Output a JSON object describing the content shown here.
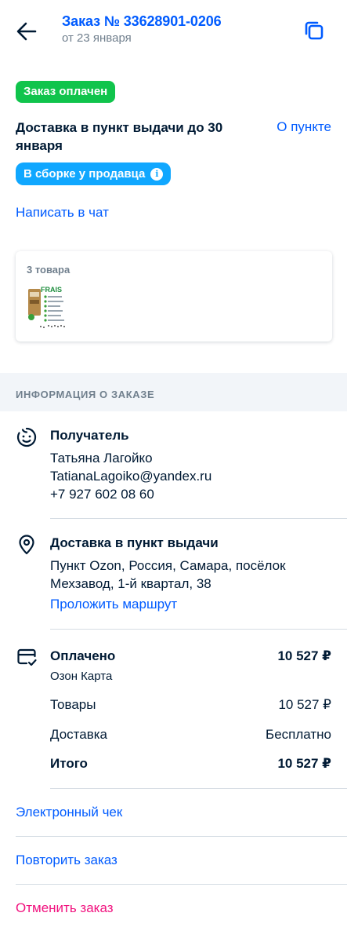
{
  "header": {
    "order_title": "Заказ № 33628901-0206",
    "order_date": "от 23 января"
  },
  "status": {
    "paid_badge": "Заказ оплачен",
    "delivery_title": "Доставка в пункт выдачи до 30 января",
    "about_point_link": "О пункте",
    "assembly_badge": "В сборке у продавца",
    "chat_link": "Написать в чат"
  },
  "items": {
    "count_label": "3 товара",
    "thumbnail": {
      "brand": "FRAIS"
    }
  },
  "order_info": {
    "section_title": "ИНФОРМАЦИЯ О ЗАКАЗЕ",
    "recipient": {
      "title": "Получатель",
      "name": "Татьяна Лагойко",
      "email": "TatianaLagoiko@yandex.ru",
      "phone": "+7 927 602 08 60"
    },
    "delivery": {
      "title": "Доставка в пункт выдачи",
      "address_line1": "Пункт Ozon, Россия, Самара, посёлок",
      "address_line2": "Мехзавод, 1-й квартал, 38",
      "route_link": "Проложить маршрут"
    },
    "payment": {
      "title": "Оплачено",
      "title_value": "10 527 ₽",
      "method": "Озон Карта",
      "goods_label": "Товары",
      "goods_value": "10 527 ₽",
      "delivery_label": "Доставка",
      "delivery_value": "Бесплатно",
      "total_label": "Итого",
      "total_value": "10 527 ₽"
    }
  },
  "actions": {
    "receipt_link": "Электронный чек",
    "repeat_link": "Повторить заказ",
    "cancel_link": "Отменить заказ"
  },
  "colors": {
    "accent": "#005bff",
    "paid_green": "#10c44c",
    "assembly_blue": "#10a7ff",
    "cancel_pink": "#f1117e",
    "muted": "#707f8d"
  },
  "icons": {
    "back": "back-arrow-icon",
    "copy": "copy-icon",
    "info": "info-icon",
    "recipient": "smiley-face-icon",
    "delivery": "location-pin-icon",
    "payment": "card-check-icon"
  }
}
